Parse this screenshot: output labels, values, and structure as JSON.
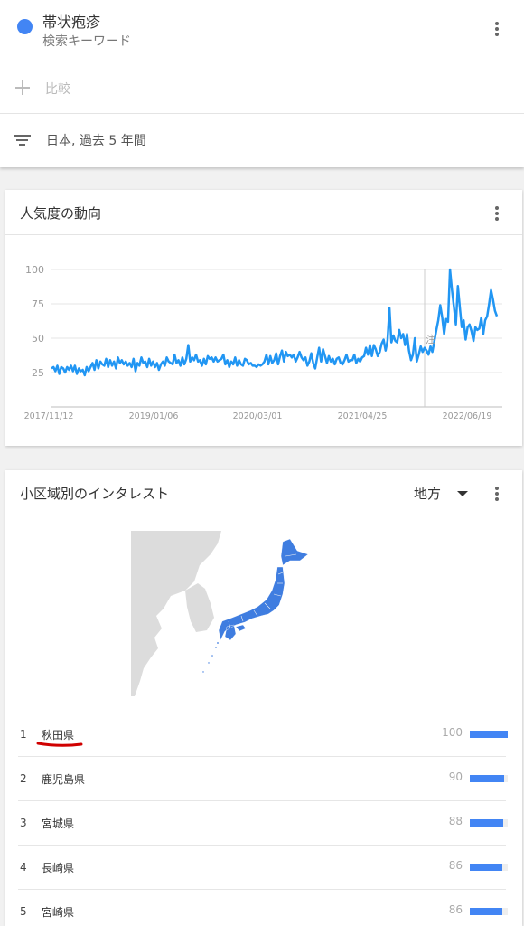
{
  "search": {
    "term": "帯状疱疹",
    "term_type": "検索キーワード",
    "term_color": "#4285f4",
    "compare_label": "比較",
    "filter_label": "日本, 過去 5 年間"
  },
  "trend_card": {
    "title": "人気度の動向",
    "line_color": "#2196f3"
  },
  "chart_data": {
    "type": "line",
    "y_ticks": [
      "100",
      "75",
      "50",
      "25"
    ],
    "x_ticks": [
      "2017/11/12",
      "2019/01/06",
      "2020/03/01",
      "2021/04/25",
      "2022/06/19"
    ],
    "ylim": [
      0,
      100
    ],
    "annotation": "注",
    "series": [
      {
        "values": [
          28,
          29,
          26,
          30,
          24,
          29,
          28,
          25,
          29,
          27,
          30,
          26,
          30,
          24,
          28,
          26,
          27,
          23,
          29,
          26,
          29,
          32,
          27,
          34,
          28,
          33,
          31,
          30,
          35,
          29,
          34,
          30,
          33,
          28,
          36,
          32,
          34,
          31,
          33,
          30,
          32,
          29,
          35,
          26,
          32,
          30,
          36,
          32,
          33,
          29,
          35,
          30,
          33,
          29,
          32,
          27,
          31,
          33,
          30,
          36,
          33,
          32,
          31,
          38,
          32,
          34,
          30,
          36,
          31,
          35,
          45,
          33,
          36,
          34,
          38,
          33,
          34,
          30,
          35,
          31,
          37,
          35,
          36,
          33,
          36,
          33,
          34,
          35,
          38,
          31,
          34,
          29,
          33,
          31,
          36,
          30,
          34,
          31,
          30,
          35,
          34,
          31,
          32,
          30,
          30,
          29,
          31,
          30,
          31,
          33,
          38,
          31,
          37,
          32,
          34,
          39,
          31,
          37,
          41,
          33,
          40,
          37,
          38,
          36,
          38,
          33,
          36,
          40,
          36,
          34,
          36,
          30,
          33,
          39,
          32,
          28,
          36,
          43,
          33,
          42,
          37,
          32,
          37,
          33,
          35,
          31,
          35,
          36,
          32,
          31,
          34,
          38,
          33,
          34,
          34,
          38,
          32,
          35,
          33,
          36,
          37,
          43,
          38,
          45,
          37,
          45,
          42,
          37,
          40,
          46,
          49,
          41,
          48,
          72,
          47,
          52,
          48,
          47,
          56,
          50,
          53,
          45,
          53,
          41,
          34,
          38,
          50,
          33,
          38,
          44,
          40,
          43,
          41,
          38,
          44,
          40,
          48,
          56,
          63,
          74,
          65,
          53,
          64,
          62,
          100,
          85,
          73,
          60,
          88,
          73,
          58,
          63,
          49,
          58,
          60,
          55,
          48,
          58,
          56,
          57,
          65,
          53,
          63,
          66,
          75,
          85,
          78,
          70,
          66
        ]
      }
    ]
  },
  "region_card": {
    "title": "小区域別のインタレスト",
    "resolution": "地方",
    "map_fill": "#3f7de0",
    "highlight_color": "#d00000",
    "rows": [
      {
        "rank": "1",
        "name": "秋田県",
        "value": "100",
        "pct": 1.0
      },
      {
        "rank": "2",
        "name": "鹿児島県",
        "value": "90",
        "pct": 0.9
      },
      {
        "rank": "3",
        "name": "宮城県",
        "value": "88",
        "pct": 0.88
      },
      {
        "rank": "4",
        "name": "長崎県",
        "value": "86",
        "pct": 0.86
      },
      {
        "rank": "5",
        "name": "宮崎県",
        "value": "86",
        "pct": 0.86
      }
    ]
  }
}
